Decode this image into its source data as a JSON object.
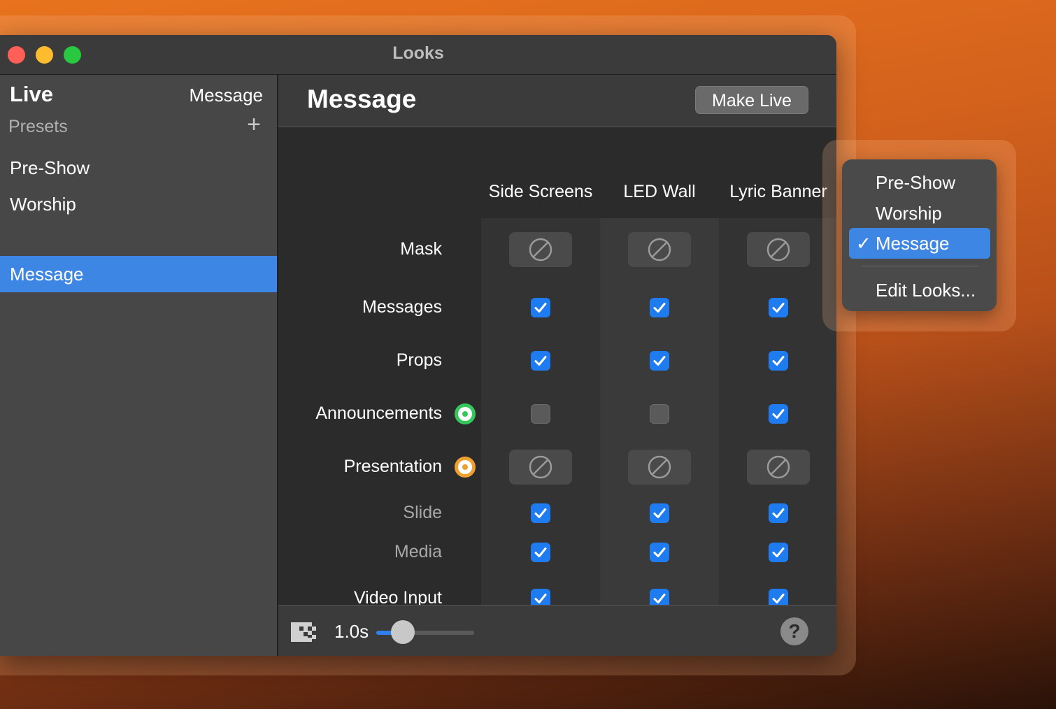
{
  "window": {
    "title": "Looks"
  },
  "sidebar": {
    "live_title": "Live",
    "live_value": "Message",
    "presets_label": "Presets",
    "add_symbol": "+",
    "items": [
      {
        "label": "Pre-Show",
        "selected": false
      },
      {
        "label": "Worship",
        "selected": false
      },
      {
        "label": "Message",
        "selected": true
      }
    ]
  },
  "main": {
    "title": "Message",
    "make_live_label": "Make Live",
    "columns": [
      "Side Screens",
      "LED Wall",
      "Lyric Banner"
    ],
    "rows": [
      {
        "label": "Mask",
        "type": "none",
        "values": [
          null,
          null,
          null
        ]
      },
      {
        "label": "Messages",
        "type": "checkbox",
        "values": [
          true,
          true,
          true
        ]
      },
      {
        "label": "Props",
        "type": "checkbox",
        "values": [
          true,
          true,
          true
        ]
      },
      {
        "label": "Announcements",
        "type": "checkbox",
        "layer_icon": "green-target-icon",
        "values": [
          false,
          false,
          true
        ]
      },
      {
        "label": "Presentation",
        "type": "none",
        "layer_icon": "orange-target-icon",
        "values": [
          null,
          null,
          null
        ]
      },
      {
        "label": "Slide",
        "type": "checkbox",
        "sub": true,
        "values": [
          true,
          true,
          true
        ]
      },
      {
        "label": "Media",
        "type": "checkbox",
        "sub": true,
        "values": [
          true,
          true,
          true
        ]
      },
      {
        "label": "Video Input",
        "type": "checkbox",
        "values": [
          true,
          true,
          true
        ]
      }
    ]
  },
  "footer": {
    "transition_icon": "checkerboard-transition-icon",
    "duration": "1.0s",
    "help_label": "?"
  },
  "popup": {
    "items": [
      {
        "label": "Pre-Show",
        "checked": false
      },
      {
        "label": "Worship",
        "checked": false
      },
      {
        "label": "Message",
        "checked": true
      }
    ],
    "check_glyph": "✓",
    "edit_label": "Edit Looks..."
  },
  "colors": {
    "accent": "#3d86e3",
    "checkbox_on": "#1f7cf0",
    "announcements_icon": "#35c759",
    "presentation_icon": "#f0a030"
  }
}
